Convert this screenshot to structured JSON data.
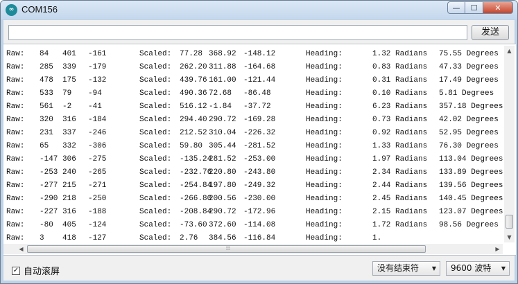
{
  "window": {
    "title": "COM156",
    "app_icon_text": "∞",
    "buttons": {
      "minimize": "—",
      "maximize": "☐",
      "close": "✕"
    }
  },
  "send_bar": {
    "input_value": "",
    "send_label": "发送"
  },
  "serial_output": {
    "lines": [
      {
        "raw_label": "Raw:",
        "raw": [
          "84",
          "401",
          "-161"
        ],
        "scaled_label": "Scaled:",
        "scaled": [
          "77.28",
          "368.92",
          "-148.12"
        ],
        "heading_label": "Heading:",
        "radians": "1.32 Radians",
        "degrees": "75.55 Degrees"
      },
      {
        "raw_label": "Raw:",
        "raw": [
          "285",
          "339",
          "-179"
        ],
        "scaled_label": "Scaled:",
        "scaled": [
          "262.20",
          "311.88",
          "-164.68"
        ],
        "heading_label": "Heading:",
        "radians": "0.83 Radians",
        "degrees": "47.33 Degrees"
      },
      {
        "raw_label": "Raw:",
        "raw": [
          "478",
          "175",
          "-132"
        ],
        "scaled_label": "Scaled:",
        "scaled": [
          "439.76",
          "161.00",
          "-121.44"
        ],
        "heading_label": "Heading:",
        "radians": "0.31 Radians",
        "degrees": "17.49 Degrees"
      },
      {
        "raw_label": "Raw:",
        "raw": [
          "533",
          "79",
          "-94"
        ],
        "scaled_label": "Scaled:",
        "scaled": [
          "490.36",
          "72.68",
          "-86.48"
        ],
        "heading_label": "Heading:",
        "radians": "0.10 Radians",
        "degrees": "5.81 Degrees"
      },
      {
        "raw_label": "Raw:",
        "raw": [
          "561",
          "-2",
          "-41"
        ],
        "scaled_label": "Scaled:",
        "scaled": [
          "516.12",
          "-1.84",
          "-37.72"
        ],
        "heading_label": "Heading:",
        "radians": "6.23 Radians",
        "degrees": "357.18 Degrees"
      },
      {
        "raw_label": "Raw:",
        "raw": [
          "320",
          "316",
          "-184"
        ],
        "scaled_label": "Scaled:",
        "scaled": [
          "294.40",
          "290.72",
          "-169.28"
        ],
        "heading_label": "Heading:",
        "radians": "0.73 Radians",
        "degrees": "42.02 Degrees"
      },
      {
        "raw_label": "Raw:",
        "raw": [
          "231",
          "337",
          "-246"
        ],
        "scaled_label": "Scaled:",
        "scaled": [
          "212.52",
          "310.04",
          "-226.32"
        ],
        "heading_label": "Heading:",
        "radians": "0.92 Radians",
        "degrees": "52.95 Degrees"
      },
      {
        "raw_label": "Raw:",
        "raw": [
          "65",
          "332",
          "-306"
        ],
        "scaled_label": "Scaled:",
        "scaled": [
          "59.80",
          "305.44",
          "-281.52"
        ],
        "heading_label": "Heading:",
        "radians": "1.33 Radians",
        "degrees": "76.30 Degrees"
      },
      {
        "raw_label": "Raw:",
        "raw": [
          "-147",
          "306",
          "-275"
        ],
        "scaled_label": "Scaled:",
        "scaled": [
          "-135.24",
          "281.52",
          "-253.00"
        ],
        "heading_label": "Heading:",
        "radians": "1.97 Radians",
        "degrees": "113.04 Degrees"
      },
      {
        "raw_label": "Raw:",
        "raw": [
          "-253",
          "240",
          "-265"
        ],
        "scaled_label": "Scaled:",
        "scaled": [
          "-232.76",
          "220.80",
          "-243.80"
        ],
        "heading_label": "Heading:",
        "radians": "2.34 Radians",
        "degrees": "133.89 Degrees"
      },
      {
        "raw_label": "Raw:",
        "raw": [
          "-277",
          "215",
          "-271"
        ],
        "scaled_label": "Scaled:",
        "scaled": [
          "-254.84",
          "197.80",
          "-249.32"
        ],
        "heading_label": "Heading:",
        "radians": "2.44 Radians",
        "degrees": "139.56 Degrees"
      },
      {
        "raw_label": "Raw:",
        "raw": [
          "-290",
          "218",
          "-250"
        ],
        "scaled_label": "Scaled:",
        "scaled": [
          "-266.80",
          "200.56",
          "-230.00"
        ],
        "heading_label": "Heading:",
        "radians": "2.45 Radians",
        "degrees": "140.45 Degrees"
      },
      {
        "raw_label": "Raw:",
        "raw": [
          "-227",
          "316",
          "-188"
        ],
        "scaled_label": "Scaled:",
        "scaled": [
          "-208.84",
          "290.72",
          "-172.96"
        ],
        "heading_label": "Heading:",
        "radians": "2.15 Radians",
        "degrees": "123.07 Degrees"
      },
      {
        "raw_label": "Raw:",
        "raw": [
          "-80",
          "405",
          "-124"
        ],
        "scaled_label": "Scaled:",
        "scaled": [
          "-73.60",
          "372.60",
          "-114.08"
        ],
        "heading_label": "Heading:",
        "radians": "1.72 Radians",
        "degrees": "98.56 Degrees"
      },
      {
        "raw_label": "Raw:",
        "raw": [
          "3",
          "418",
          "-127"
        ],
        "scaled_label": "Scaled:",
        "scaled": [
          "2.76",
          "384.56",
          "-116.84"
        ],
        "heading_label": "Heading:",
        "radians": "1.",
        "degrees": ""
      }
    ]
  },
  "scrollbars": {
    "up_arrow": "▲",
    "down_arrow": "▼",
    "left_arrow": "◀",
    "right_arrow": "▶",
    "grip": "⁞⁞⁞"
  },
  "bottom_bar": {
    "autoscroll_checked": true,
    "autoscroll_check_mark": "✓",
    "autoscroll_label": "自动滚屏",
    "line_ending_value": "没有结束符",
    "baud_value": "9600 波特",
    "dropdown_caret": "▼"
  },
  "colors": {
    "title_bar": "#c4d7ec",
    "close_button": "#c6442b",
    "app_icon": "#1e8a9a"
  }
}
